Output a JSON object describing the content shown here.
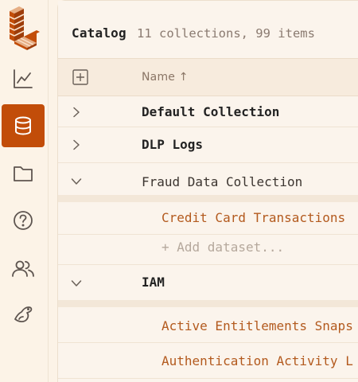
{
  "sidebar": {
    "items": [
      {
        "name": "logo-icon"
      },
      {
        "name": "chart-icon"
      },
      {
        "name": "database-icon",
        "active": true
      },
      {
        "name": "folder-icon"
      },
      {
        "name": "help-icon"
      },
      {
        "name": "users-icon"
      },
      {
        "name": "seal-icon"
      }
    ],
    "accent": "#c24d09"
  },
  "header": {
    "title": "Catalog",
    "counts": "11 collections, 99 items"
  },
  "table": {
    "expand_all_icon": "plus-square-icon",
    "name_header": "Name ↑",
    "rows": [
      {
        "label": "Default Collection",
        "expanded": false,
        "chevron": "chevron-right-icon"
      },
      {
        "label": "DLP Logs",
        "expanded": false,
        "chevron": "chevron-right-icon"
      },
      {
        "label": "Fraud Data Collection",
        "expanded": true,
        "chevron": "chevron-down-icon"
      },
      {
        "label": "IAM",
        "expanded": true,
        "chevron": "chevron-down-icon"
      }
    ],
    "fraud_children": [
      {
        "label": "Credit Card Transactions"
      }
    ],
    "add_dataset": "+ Add dataset...",
    "iam_children": [
      {
        "label": "Active Entitlements Snaps"
      },
      {
        "label": "Authentication Activity L"
      }
    ]
  }
}
